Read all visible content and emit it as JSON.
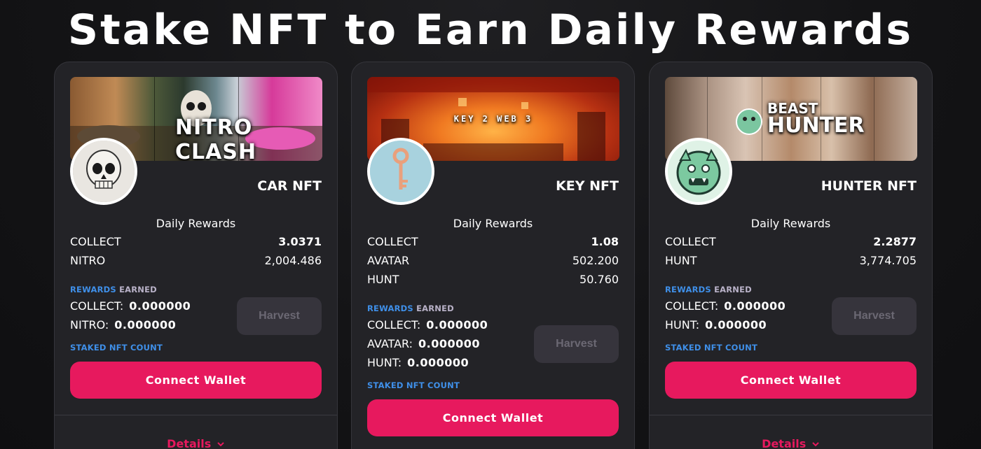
{
  "headline": "Stake NFT to Earn Daily Rewards",
  "colors": {
    "accent": "#e7195e",
    "label_blue": "#3f8fe8",
    "card_bg": "#232327",
    "harvest_disabled": "#36343c"
  },
  "cards": [
    {
      "banner_text": "NITRO CLASH",
      "avatar_icon": "skull-icon",
      "name": "CAR NFT",
      "daily_rewards_title": "Daily Rewards",
      "rewards": [
        {
          "label": "COLLECT",
          "value": "3.0371"
        },
        {
          "label": "NITRO",
          "value": "2,004.486"
        }
      ],
      "rewards_label_a": "REWARDS",
      "rewards_label_b": "EARNED",
      "earned": [
        {
          "label": "COLLECT:",
          "amount": "0.000000"
        },
        {
          "label": "NITRO:",
          "amount": "0.000000"
        }
      ],
      "harvest_label": "Harvest",
      "staked_label": "STAKED NFT COUNT",
      "connect_label": "Connect Wallet",
      "details_label": "Details"
    },
    {
      "banner_text": "KEY 2 WEB 3",
      "avatar_icon": "key-icon",
      "name": "KEY NFT",
      "daily_rewards_title": "Daily Rewards",
      "rewards": [
        {
          "label": "COLLECT",
          "value": "1.08"
        },
        {
          "label": "AVATAR",
          "value": "502.200"
        },
        {
          "label": "HUNT",
          "value": "50.760"
        }
      ],
      "rewards_label_a": "REWARDS",
      "rewards_label_b": "EARNED",
      "earned": [
        {
          "label": "COLLECT:",
          "amount": "0.000000"
        },
        {
          "label": "AVATAR:",
          "amount": "0.000000"
        },
        {
          "label": "HUNT:",
          "amount": "0.000000"
        }
      ],
      "harvest_label": "Harvest",
      "staked_label": "STAKED NFT COUNT",
      "connect_label": "Connect Wallet"
    },
    {
      "banner_text_1": "BEAST",
      "banner_text_2": "HUNTER",
      "avatar_icon": "beast-icon",
      "name": "HUNTER NFT",
      "daily_rewards_title": "Daily Rewards",
      "rewards": [
        {
          "label": "COLLECT",
          "value": "2.2877"
        },
        {
          "label": "HUNT",
          "value": "3,774.705"
        }
      ],
      "rewards_label_a": "REWARDS",
      "rewards_label_b": "EARNED",
      "earned": [
        {
          "label": "COLLECT:",
          "amount": "0.000000"
        },
        {
          "label": "HUNT:",
          "amount": "0.000000"
        }
      ],
      "harvest_label": "Harvest",
      "staked_label": "STAKED NFT COUNT",
      "connect_label": "Connect Wallet",
      "details_label": "Details"
    }
  ]
}
